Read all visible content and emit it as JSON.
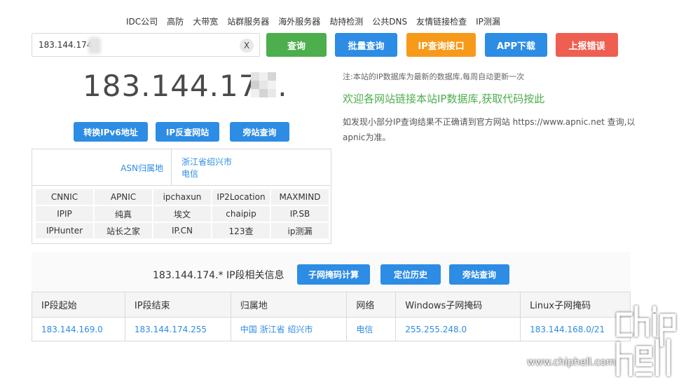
{
  "nav": [
    "IDC公司",
    "高防",
    "大带宽",
    "站群服务器",
    "海外服务器",
    "劫持检测",
    "公共DNS",
    "友情链接检查",
    "IP测漏"
  ],
  "search": {
    "value": "183.144.174.",
    "clear_label": "X"
  },
  "buttons": {
    "query": "查询",
    "batch": "批量查询",
    "api": "IP查询接口",
    "app": "APP下载",
    "report": "上报错误"
  },
  "result": {
    "ip_display": "183.144.174."
  },
  "secondary_buttons": {
    "ipv6": "转换IPv6地址",
    "reverse": "IP反查网站",
    "nearby": "旁站查询"
  },
  "notes": {
    "line1": "注:本站的IP数据库为最新的数据库,每周自动更新一次",
    "line2": "欢迎各网站链接本站IP数据库,获取代码按此",
    "line3": "如发现小部分IP查询结果不正确请到官方网站 https://www.apnic.net 查询,以apnic为准。"
  },
  "asn": {
    "label": "ASN归属地",
    "location": "浙江省绍兴市",
    "isp": "电信"
  },
  "databases": [
    "CNNIC",
    "APNIC",
    "ipchaxun",
    "IP2Location",
    "MAXMIND",
    "IPIP",
    "纯真",
    "埃文",
    "chaipip",
    "IP.SB",
    "IPHunter",
    "站长之家",
    "IP.CN",
    "123查",
    "ip测漏"
  ],
  "segment": {
    "title": "183.144.174.* IP段相关信息",
    "buttons": {
      "mask": "子网掩码计算",
      "location_history": "定位历史",
      "nearby": "旁站查询"
    },
    "columns": [
      "IP段起始",
      "IP段结束",
      "归属地",
      "网络",
      "Windows子网掩码",
      "Linux子网掩码"
    ],
    "rows": [
      [
        "183.144.169.0",
        "183.144.174.255",
        "中国 浙江省 绍兴市",
        "电信",
        "255.255.248.0",
        "183.144.168.0/21"
      ]
    ]
  },
  "watermark": {
    "url": "www.chiphell.com",
    "logo_text": "chip hell"
  },
  "colors": {
    "green": "#4cae4c",
    "blue": "#2d8ce4",
    "orange": "#f79a1a",
    "red": "#ee5f52"
  }
}
